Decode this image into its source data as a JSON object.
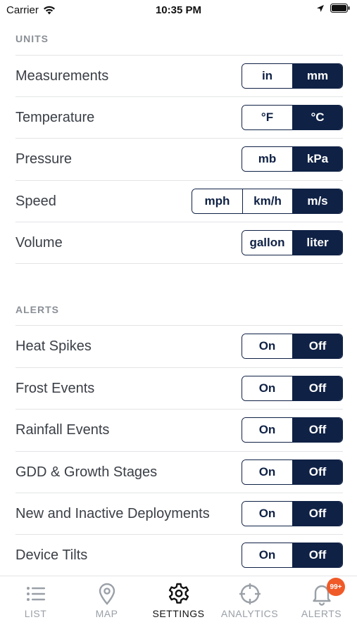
{
  "status_bar": {
    "carrier": "Carrier",
    "time": "10:35 PM"
  },
  "units": {
    "header": "UNITS",
    "rows": [
      {
        "label": "Measurements",
        "options": [
          "in",
          "mm"
        ],
        "selected": 1
      },
      {
        "label": "Temperature",
        "options": [
          "°F",
          "°C"
        ],
        "selected": 1
      },
      {
        "label": "Pressure",
        "options": [
          "mb",
          "kPa"
        ],
        "selected": 1
      },
      {
        "label": "Speed",
        "options": [
          "mph",
          "km/h",
          "m/s"
        ],
        "selected": 2
      },
      {
        "label": "Volume",
        "options": [
          "gallon",
          "liter"
        ],
        "selected": 1
      }
    ]
  },
  "alerts": {
    "header": "ALERTS",
    "rows": [
      {
        "label": "Heat Spikes",
        "options": [
          "On",
          "Off"
        ],
        "selected": 1
      },
      {
        "label": "Frost Events",
        "options": [
          "On",
          "Off"
        ],
        "selected": 1
      },
      {
        "label": "Rainfall Events",
        "options": [
          "On",
          "Off"
        ],
        "selected": 1
      },
      {
        "label": "GDD & Growth Stages",
        "options": [
          "On",
          "Off"
        ],
        "selected": 1
      },
      {
        "label": "New and Inactive Deployments",
        "options": [
          "On",
          "Off"
        ],
        "selected": 1
      },
      {
        "label": "Device Tilts",
        "options": [
          "On",
          "Off"
        ],
        "selected": 1
      }
    ]
  },
  "tab_bar": {
    "tabs": [
      {
        "label": "LIST",
        "icon": "list-icon",
        "active": false
      },
      {
        "label": "MAP",
        "icon": "map-pin-icon",
        "active": false
      },
      {
        "label": "SETTINGS",
        "icon": "gear-icon",
        "active": true
      },
      {
        "label": "ANALYTICS",
        "icon": "crosshair-icon",
        "active": false
      },
      {
        "label": "ALERTS",
        "icon": "bell-icon",
        "active": false,
        "badge": "99+"
      }
    ]
  },
  "colors": {
    "accent": "#0f2145",
    "badge": "#f05a28",
    "divider": "#e2e4e7",
    "inactive": "#9aa0a7"
  }
}
